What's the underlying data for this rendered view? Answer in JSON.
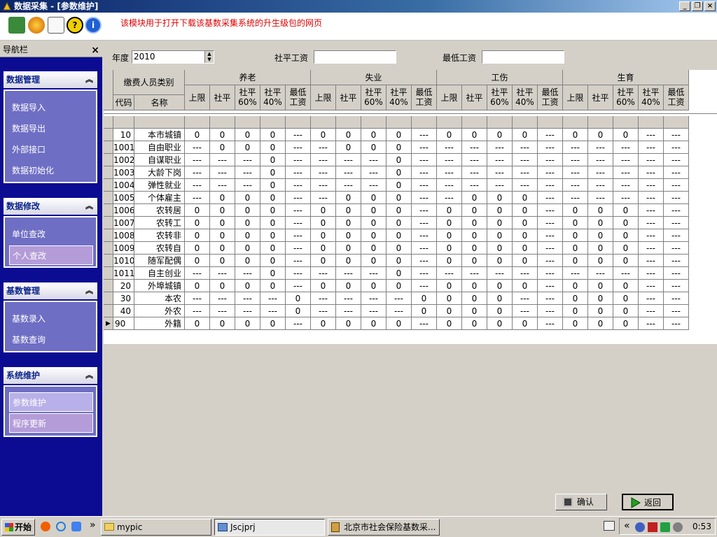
{
  "window": {
    "title": "数据采集 - [参数维护]"
  },
  "toolbar": {
    "notice": "该模块用于打开下载该基数采集系统的升生级包的网页"
  },
  "nav": {
    "title": "导航栏",
    "close": "×",
    "groups": [
      {
        "title": "数据管理",
        "items": [
          "数据导入",
          "数据导出",
          "外部接口",
          "数据初始化"
        ]
      },
      {
        "title": "数据修改",
        "items": [
          "单位查改",
          "个人查改"
        ]
      },
      {
        "title": "基数管理",
        "items": [
          "基数录入",
          "基数查询"
        ]
      },
      {
        "title": "系统维护",
        "items": [
          "参数维护",
          "程序更新"
        ]
      }
    ]
  },
  "form": {
    "year_label": "年度",
    "year_value": "2010",
    "avg_wage_label": "社平工资",
    "avg_wage_value": "",
    "min_wage_label": "最低工资",
    "min_wage_value": ""
  },
  "grid": {
    "col_header_category": "缴费人员类别",
    "col_code": "代码",
    "col_name": "名称",
    "groups": [
      "养老",
      "失业",
      "工伤",
      "生育"
    ],
    "subcols": [
      "上限",
      "社平",
      "社平\n60%",
      "社平\n40%",
      "最低\n工资"
    ],
    "rows": [
      {
        "code": "10",
        "name": "本市城镇",
        "v": [
          "0",
          "0",
          "0",
          "0",
          "---",
          "0",
          "0",
          "0",
          "0",
          "---",
          "0",
          "0",
          "0",
          "0",
          "---",
          "0",
          "0",
          "0",
          "---",
          "---"
        ]
      },
      {
        "code": "1001",
        "name": "自由职业",
        "v": [
          "---",
          "0",
          "0",
          "0",
          "---",
          "---",
          "0",
          "0",
          "0",
          "---",
          "---",
          "---",
          "---",
          "---",
          "---",
          "---",
          "---",
          "---",
          "---",
          "---"
        ]
      },
      {
        "code": "1002",
        "name": "自谋职业",
        "v": [
          "---",
          "---",
          "---",
          "0",
          "---",
          "---",
          "---",
          "---",
          "0",
          "---",
          "---",
          "---",
          "---",
          "---",
          "---",
          "---",
          "---",
          "---",
          "---",
          "---"
        ]
      },
      {
        "code": "1003",
        "name": "大龄下岗",
        "v": [
          "---",
          "---",
          "---",
          "0",
          "---",
          "---",
          "---",
          "---",
          "0",
          "---",
          "---",
          "---",
          "---",
          "---",
          "---",
          "---",
          "---",
          "---",
          "---",
          "---"
        ]
      },
      {
        "code": "1004",
        "name": "弹性就业",
        "v": [
          "---",
          "---",
          "---",
          "0",
          "---",
          "---",
          "---",
          "---",
          "0",
          "---",
          "---",
          "---",
          "---",
          "---",
          "---",
          "---",
          "---",
          "---",
          "---",
          "---"
        ]
      },
      {
        "code": "1005",
        "name": "个体雇主",
        "v": [
          "---",
          "0",
          "0",
          "0",
          "---",
          "---",
          "0",
          "0",
          "0",
          "---",
          "---",
          "0",
          "0",
          "0",
          "---",
          "---",
          "---",
          "---",
          "---",
          "---"
        ]
      },
      {
        "code": "1006",
        "name": "农转居",
        "v": [
          "0",
          "0",
          "0",
          "0",
          "---",
          "0",
          "0",
          "0",
          "0",
          "---",
          "0",
          "0",
          "0",
          "0",
          "---",
          "0",
          "0",
          "0",
          "---",
          "---"
        ]
      },
      {
        "code": "1007",
        "name": "农转工",
        "v": [
          "0",
          "0",
          "0",
          "0",
          "---",
          "0",
          "0",
          "0",
          "0",
          "---",
          "0",
          "0",
          "0",
          "0",
          "---",
          "0",
          "0",
          "0",
          "---",
          "---"
        ]
      },
      {
        "code": "1008",
        "name": "农转非",
        "v": [
          "0",
          "0",
          "0",
          "0",
          "---",
          "0",
          "0",
          "0",
          "0",
          "---",
          "0",
          "0",
          "0",
          "0",
          "---",
          "0",
          "0",
          "0",
          "---",
          "---"
        ]
      },
      {
        "code": "1009",
        "name": "农转自",
        "v": [
          "0",
          "0",
          "0",
          "0",
          "---",
          "0",
          "0",
          "0",
          "0",
          "---",
          "0",
          "0",
          "0",
          "0",
          "---",
          "0",
          "0",
          "0",
          "---",
          "---"
        ]
      },
      {
        "code": "1010",
        "name": "随军配偶",
        "v": [
          "0",
          "0",
          "0",
          "0",
          "---",
          "0",
          "0",
          "0",
          "0",
          "---",
          "0",
          "0",
          "0",
          "0",
          "---",
          "0",
          "0",
          "0",
          "---",
          "---"
        ]
      },
      {
        "code": "1011",
        "name": "自主创业",
        "v": [
          "---",
          "---",
          "---",
          "0",
          "---",
          "---",
          "---",
          "---",
          "0",
          "---",
          "---",
          "---",
          "---",
          "---",
          "---",
          "---",
          "---",
          "---",
          "---",
          "---"
        ]
      },
      {
        "code": "20",
        "name": "外埠城镇",
        "v": [
          "0",
          "0",
          "0",
          "0",
          "---",
          "0",
          "0",
          "0",
          "0",
          "---",
          "0",
          "0",
          "0",
          "0",
          "---",
          "0",
          "0",
          "0",
          "---",
          "---"
        ]
      },
      {
        "code": "30",
        "name": "本农",
        "v": [
          "---",
          "---",
          "---",
          "---",
          "0",
          "---",
          "---",
          "---",
          "---",
          "0",
          "0",
          "0",
          "0",
          "---",
          "---",
          "0",
          "0",
          "0",
          "---",
          "---"
        ]
      },
      {
        "code": "40",
        "name": "外农",
        "v": [
          "---",
          "---",
          "---",
          "---",
          "0",
          "---",
          "---",
          "---",
          "---",
          "0",
          "0",
          "0",
          "0",
          "---",
          "---",
          "0",
          "0",
          "0",
          "---",
          "---"
        ]
      },
      {
        "code": "90",
        "name": "外籍",
        "v": [
          "0",
          "0",
          "0",
          "0",
          "---",
          "0",
          "0",
          "0",
          "0",
          "---",
          "0",
          "0",
          "0",
          "0",
          "---",
          "0",
          "0",
          "0",
          "---",
          "---"
        ]
      }
    ]
  },
  "buttons": {
    "confirm": "确认",
    "back": "返回"
  },
  "taskbar": {
    "start": "开始",
    "tasks": [
      "mypic",
      "Jscjprj",
      "北京市社会保险基数采..."
    ],
    "clock": "0:53"
  }
}
